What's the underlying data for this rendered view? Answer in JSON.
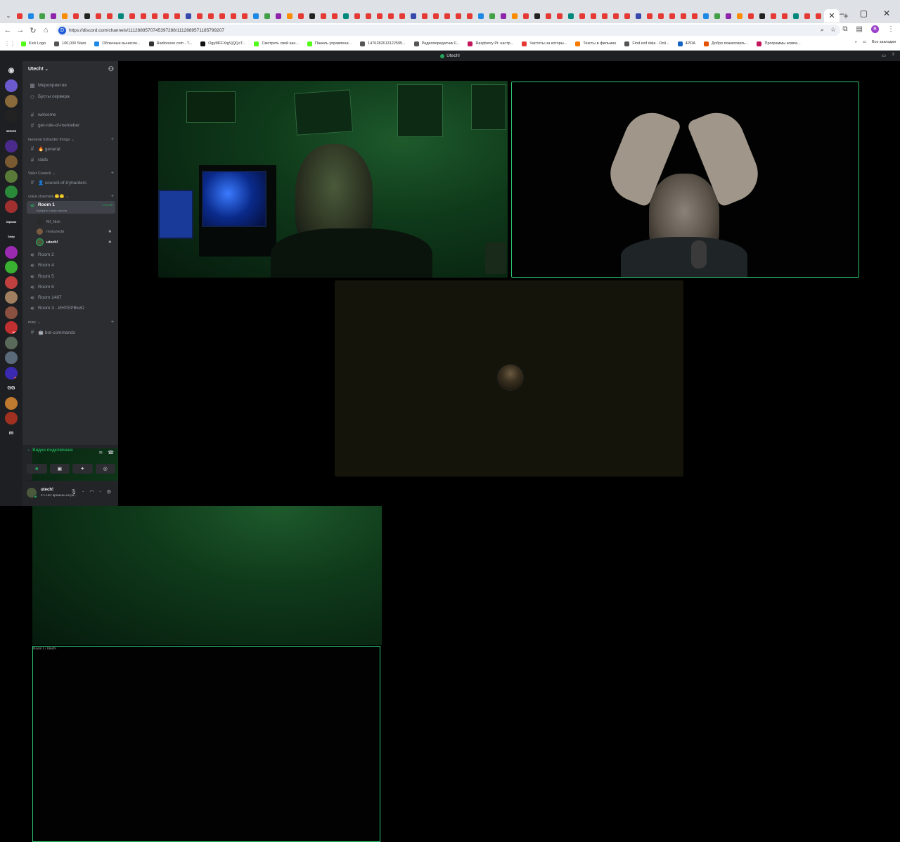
{
  "browser": {
    "url": "https://discord.com/channels/1112889570745397288/1112889571185799207",
    "tab_icon_colors": [
      "#e53935",
      "#1e88e5",
      "#43a047",
      "#8e24aa",
      "#fb8c00",
      "#e53935",
      "#222222",
      "#e53935",
      "#e53935",
      "#00897b",
      "#e53935",
      "#e53935",
      "#e53935",
      "#e53935",
      "#e53935",
      "#3949ab",
      "#e53935",
      "#e53935",
      "#e53935",
      "#e53935"
    ],
    "bookmarks": [
      {
        "label": "Kick Logo",
        "color": "#53fc18"
      },
      {
        "label": "100,000 Stars",
        "color": "#555555"
      },
      {
        "label": "Облачные вычисле...",
        "color": "#1e88e5"
      },
      {
        "label": "Radiooooo.com - T...",
        "color": "#333333"
      },
      {
        "label": "OgyMFFXtgVjQQcT...",
        "color": "#111111"
      },
      {
        "label": "Смотреть свой кан...",
        "color": "#53fc18"
      },
      {
        "label": "Панель управлени...",
        "color": "#53fc18"
      },
      {
        "label": "1476282613122595...",
        "color": "#555555"
      },
      {
        "label": "Радиопередатчик F...",
        "color": "#555555"
      },
      {
        "label": "Raspberry Pi: настр...",
        "color": "#c2185b"
      },
      {
        "label": "Частоты на которы...",
        "color": "#e53935"
      },
      {
        "label": "Тексты в фильмах",
        "color": "#f57c00"
      },
      {
        "label": "Find exif data - Onli...",
        "color": "#555555"
      },
      {
        "label": "4PDA",
        "color": "#1565c0"
      },
      {
        "label": "Добро пожаловать...",
        "color": "#e65100"
      },
      {
        "label": "Программы компа...",
        "color": "#c2185b"
      }
    ],
    "all_bookmarks": "Все закладки",
    "profile_letter": "B"
  },
  "discord": {
    "window_title": "Utech!",
    "server_name": "Utech!",
    "top_items": [
      {
        "label": "Мероприятия",
        "icon": "calendar-icon"
      },
      {
        "label": "Бусты сервера",
        "icon": "boost-icon"
      }
    ],
    "channels_top": [
      {
        "label": "welcome"
      },
      {
        "label": "get-role-of-memeber"
      }
    ],
    "cat_general": "General tryharder things",
    "general_channels": [
      {
        "label": "🔥 general"
      },
      {
        "label": "raids"
      }
    ],
    "cat_valor": "Valor Council",
    "valor_channels": [
      {
        "label": "👤 council-of-tryharders"
      }
    ],
    "cat_voice": "voice channels 🙂🙂",
    "room1": {
      "label": "Room 1",
      "timer": "1:51:49",
      "status": "Выбрать статус канала"
    },
    "voice_users": [
      {
        "name": "MI_Nick",
        "color": "#2a2a2a",
        "camera": false
      },
      {
        "name": "morozecki",
        "color": "#7a5a40",
        "camera": true
      },
      {
        "name": "utech!",
        "color": "#4b5a3c",
        "camera": true
      }
    ],
    "rooms": [
      {
        "label": "Room 2"
      },
      {
        "label": "Room 4"
      },
      {
        "label": "Room 5"
      },
      {
        "label": "Room 6"
      },
      {
        "label": "Room 1487"
      },
      {
        "label": "Room 3 - ИНТЕРВЬЮ"
      }
    ],
    "cat_misc": "misc",
    "misc_channels": [
      {
        "label": "🤖 bot-commands"
      }
    ],
    "voice_status": {
      "title": "Видео подключено",
      "subtitle": "Room 1 / Utech!"
    },
    "user": {
      "name": "utech!",
      "status": "4! • Нет времени на ра..."
    },
    "server_icons": [
      {
        "color": "#6a5acd",
        "text": "",
        "badge": ""
      },
      {
        "color": "#8a6a3a",
        "text": "",
        "badge": ""
      },
      {
        "color": "#222222",
        "text": "",
        "badge": ""
      },
      {
        "color": "#1e1f22",
        "text": "SERVER",
        "badge": ""
      },
      {
        "color": "#4a2a8a",
        "text": "",
        "badge": ""
      },
      {
        "color": "#7a5a30",
        "text": "",
        "badge": ""
      },
      {
        "color": "#5a7a3a",
        "text": "",
        "badge": ""
      },
      {
        "color": "#2a8a3a",
        "text": "",
        "badge": ""
      },
      {
        "color": "#a03030",
        "text": "",
        "badge": ""
      },
      {
        "color": "#1e1f22",
        "text": "Зорники",
        "badge": ""
      },
      {
        "color": "#1e1f22",
        "text": "Stoky",
        "badge": ""
      },
      {
        "color": "#9a2ab0",
        "text": "",
        "badge": ""
      },
      {
        "color": "#3ab030",
        "text": "",
        "badge": ""
      },
      {
        "color": "#c04040",
        "text": "",
        "badge": "6"
      },
      {
        "color": "#a08060",
        "text": "",
        "badge": ""
      },
      {
        "color": "#8a5040",
        "text": "",
        "badge": ""
      },
      {
        "color": "#c03030",
        "text": "",
        "badge": "649"
      },
      {
        "color": "#5a6a5a",
        "text": "",
        "badge": ""
      },
      {
        "color": "#5a6a7a",
        "text": "",
        "badge": ""
      },
      {
        "color": "#3a2ab0",
        "text": "",
        "badge": "22"
      },
      {
        "color": "#1e1f22",
        "text": "GG",
        "badge": ""
      },
      {
        "color": "#c07a30",
        "text": "",
        "badge": ""
      },
      {
        "color": "#a03020",
        "text": "",
        "badge": ""
      },
      {
        "color": "#1e1f22",
        "text": "m",
        "badge": ""
      }
    ]
  }
}
